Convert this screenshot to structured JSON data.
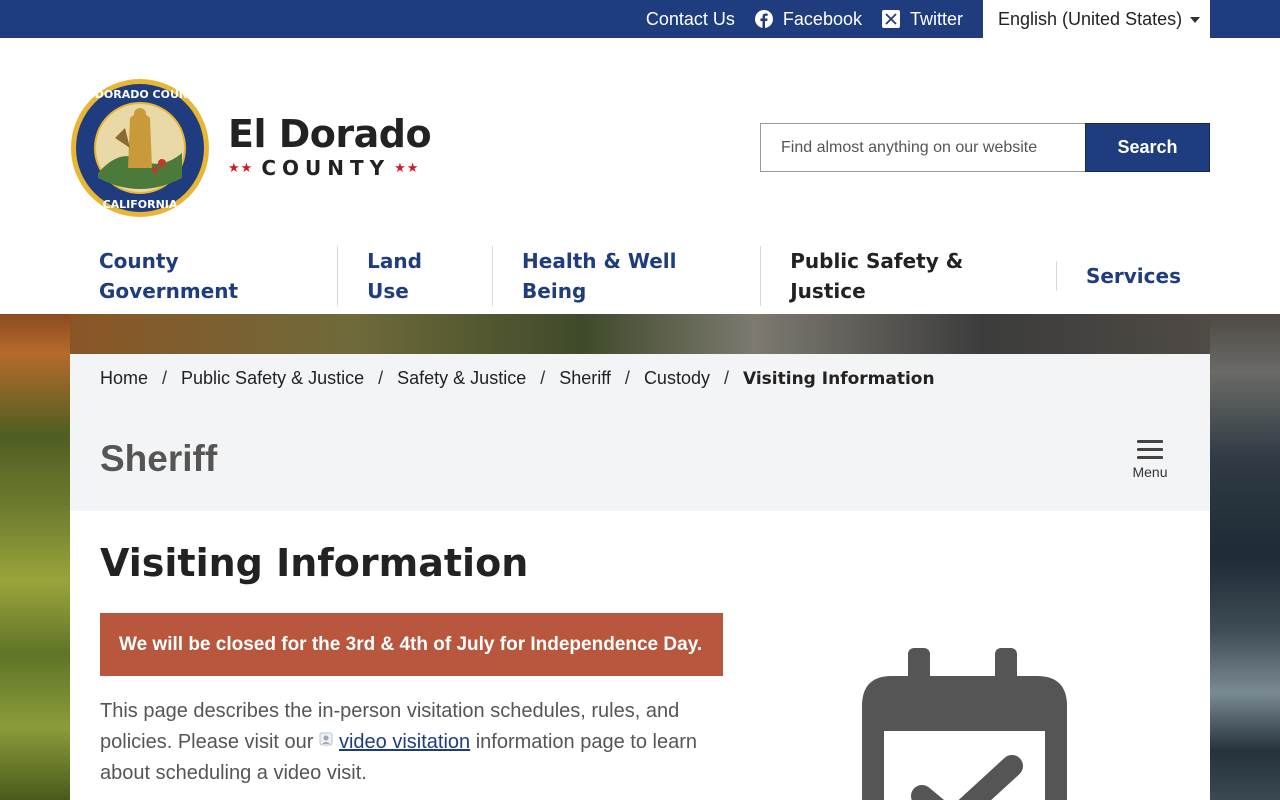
{
  "topbar": {
    "contact_label": "Contact Us",
    "facebook_label": "Facebook",
    "twitter_label": "Twitter",
    "language_selected": "English (United States)"
  },
  "brand": {
    "name": "El Dorado",
    "sub": "COUNTY",
    "stars": "★★",
    "seal_top_text": "EL DORADO COUNTY",
    "seal_bottom_text": "CALIFORNIA"
  },
  "search": {
    "placeholder": "Find almost anything on our website",
    "value": "",
    "button_label": "Search"
  },
  "nav": {
    "items": [
      {
        "label": "County Government"
      },
      {
        "label": "Land Use"
      },
      {
        "label": "Health & Well Being"
      },
      {
        "label": "Public Safety & Justice"
      },
      {
        "label": "Services"
      }
    ]
  },
  "breadcrumb": {
    "items": [
      "Home",
      "Public Safety & Justice",
      "Safety & Justice",
      "Sheriff",
      "Custody"
    ],
    "current": "Visiting Information",
    "separator": "/"
  },
  "section": {
    "title": "Sheriff",
    "menu_label": "Menu"
  },
  "content": {
    "title": "Visiting Information",
    "alert": "We will be closed for the 3rd & 4th of July for Independence Day.",
    "intro_before": "This page describes the in-person visitation schedules, rules, and policies. Please visit our ",
    "intro_link": "video visitation",
    "intro_after": " information page to learn about scheduling a video visit."
  },
  "colors": {
    "brand_blue": "#1f3c7f",
    "alert_bg": "#b8563e",
    "star_red": "#d4192b",
    "panel_gray": "#f3f4f6"
  },
  "icons": [
    "facebook-icon",
    "twitter-x-icon",
    "chevron-down-icon",
    "hamburger-icon",
    "calendar-check-icon",
    "external-link-icon",
    "county-seal-logo"
  ]
}
